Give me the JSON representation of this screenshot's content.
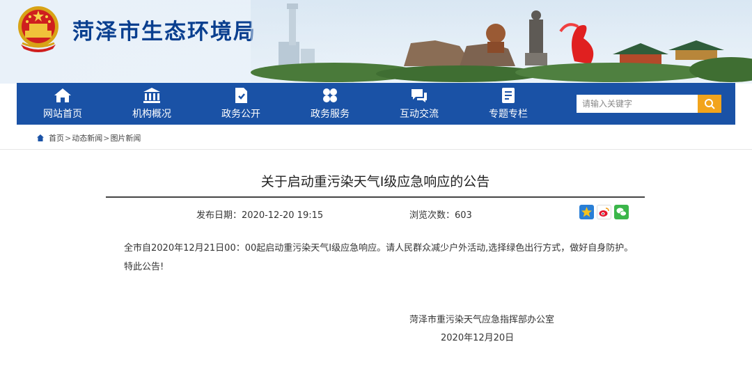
{
  "header": {
    "site_title": "菏泽市生态环境局"
  },
  "nav": {
    "items": [
      {
        "label": "网站首页",
        "icon": "home-icon"
      },
      {
        "label": "机构概况",
        "icon": "institution-icon"
      },
      {
        "label": "政务公开",
        "icon": "document-icon"
      },
      {
        "label": "政务服务",
        "icon": "grid-icon"
      },
      {
        "label": "互动交流",
        "icon": "chat-icon"
      },
      {
        "label": "专题专栏",
        "icon": "notepad-icon"
      }
    ],
    "search_placeholder": "请输入关键字"
  },
  "breadcrumb": {
    "items": [
      "首页",
      "动态新闻",
      "图片新闻"
    ],
    "separator": ">"
  },
  "article": {
    "title": "关于启动重污染天气Ⅰ级应急响应的公告",
    "date_text": "发布日期：2020-12-20 19:15",
    "views_text": "浏览次数：603",
    "paragraph1": "全市自2020年12月21日00：00起启动重污染天气Ⅰ级应急响应。请人民群众减少户外活动,选择绿色出行方式，做好自身防护。",
    "paragraph2": "特此公告!",
    "signature_org": "菏泽市重污染天气应急指挥部办公室",
    "signature_date": "2020年12月20日"
  },
  "share": {
    "buttons": [
      "qzone-icon",
      "weibo-icon",
      "wechat-icon"
    ]
  },
  "colors": {
    "nav_blue": "#1a52a6",
    "title_blue": "#0a3f8f",
    "search_orange": "#f2a41c"
  }
}
